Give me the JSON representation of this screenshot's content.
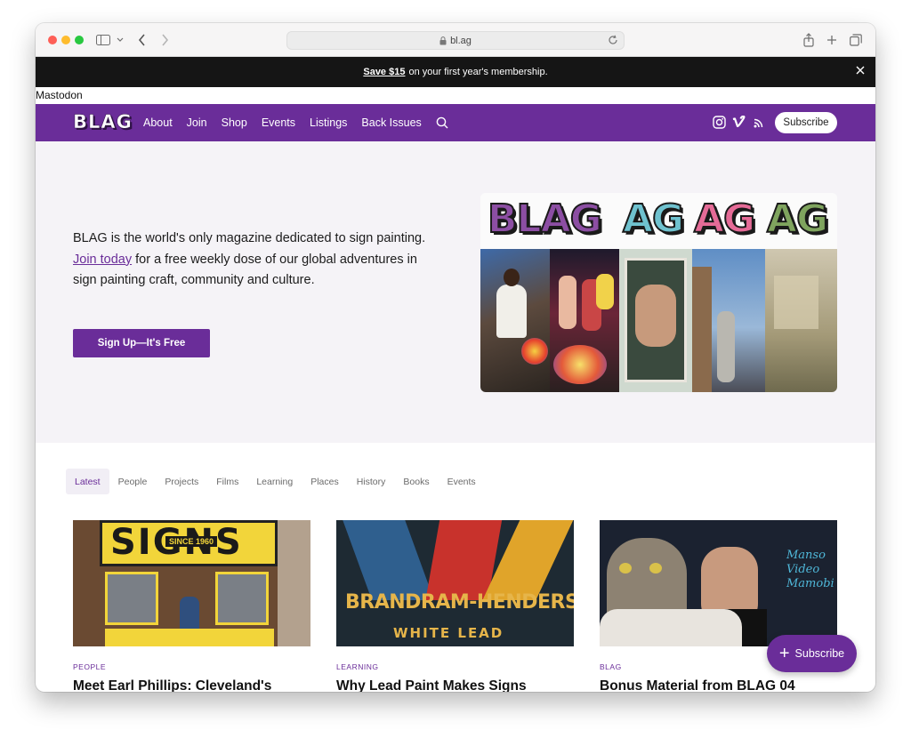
{
  "browser": {
    "url": "bl.ag"
  },
  "promo": {
    "highlight": "Save $15",
    "text": "on your first year's membership."
  },
  "mastodon": "Mastodon",
  "nav": {
    "logo": "BLAG",
    "links": [
      "About",
      "Join",
      "Shop",
      "Events",
      "Listings",
      "Back Issues"
    ],
    "subscribe": "Subscribe"
  },
  "hero": {
    "text_before": "BLAG is the world's only magazine dedicated to sign painting. ",
    "link": "Join today",
    "text_after": " for a free weekly dose of our global adventures in sign painting craft, community and culture.",
    "cta": "Sign Up—It's Free",
    "cover_words": [
      "BLAG",
      "AG",
      "AG",
      "AG"
    ],
    "cover_colors": [
      "#8c4ea3",
      "#6fc2cf",
      "#e56b97",
      "#7fa45e"
    ]
  },
  "categories": [
    "Latest",
    "People",
    "Projects",
    "Films",
    "Learning",
    "Places",
    "History",
    "Books",
    "Events"
  ],
  "cards": [
    {
      "tag": "PEOPLE",
      "title": "Meet Earl Phillips: Cleveland's",
      "sign": "SIGNS",
      "sub": "SINCE 1960"
    },
    {
      "tag": "LEARNING",
      "title": "Why Lead Paint Makes Signs",
      "sign": "BRANDRAM-HENDERSON",
      "sub": "WHITE LEAD"
    },
    {
      "tag": "BLAG",
      "title": "Bonus Material from BLAG 04",
      "sign": "Manso Video Mamobi",
      "sub": ""
    }
  ],
  "float_subscribe": "Subscribe"
}
